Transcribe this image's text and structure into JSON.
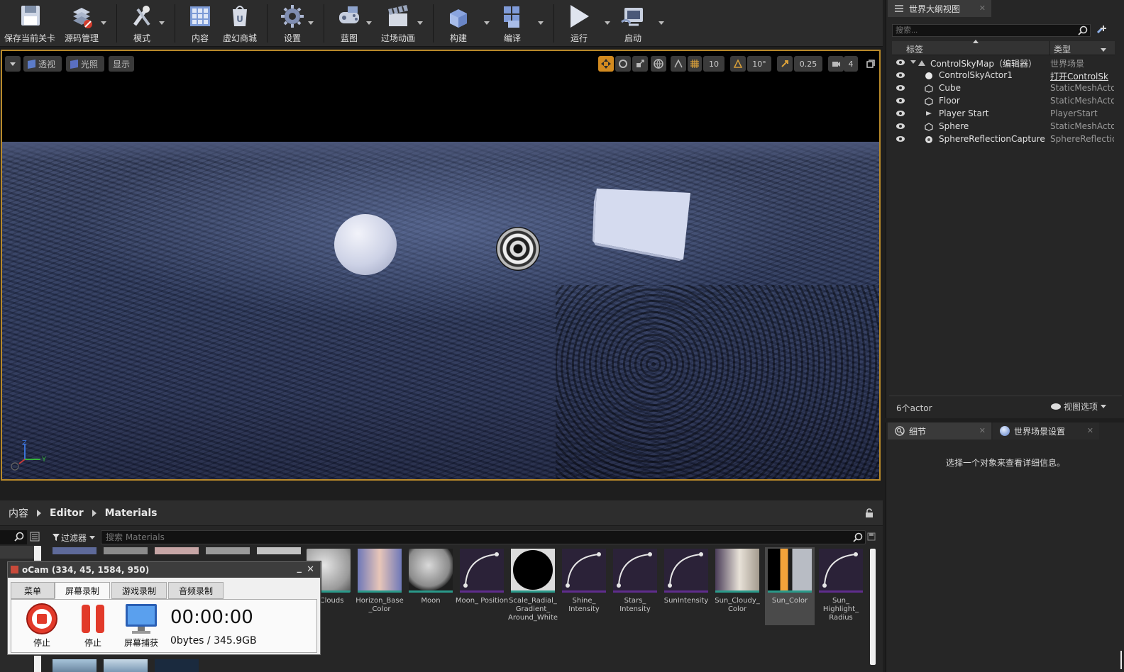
{
  "toolbar": {
    "items": [
      {
        "label": "保存当前关卡",
        "icon": "save-icon"
      },
      {
        "label": "源码管理",
        "icon": "source-control-icon"
      },
      {
        "label": "模式",
        "icon": "modes-icon"
      },
      {
        "label": "内容",
        "icon": "content-icon"
      },
      {
        "label": "虚幻商城",
        "icon": "marketplace-icon"
      },
      {
        "label": "设置",
        "icon": "settings-icon"
      },
      {
        "label": "蓝图",
        "icon": "blueprint-icon"
      },
      {
        "label": "过场动画",
        "icon": "cinematics-icon"
      },
      {
        "label": "构建",
        "icon": "build-icon"
      },
      {
        "label": "编译",
        "icon": "compile-icon"
      },
      {
        "label": "运行",
        "icon": "play-icon"
      },
      {
        "label": "启动",
        "icon": "launch-icon"
      }
    ]
  },
  "viewport": {
    "perspective_label": "透视",
    "lit_label": "光照",
    "show_label": "显示",
    "grid_snap_value": "10",
    "rotation_snap_value": "10°",
    "scale_snap_value": "0.25",
    "camera_speed_value": "4",
    "axis_z": "Z",
    "axis_y": "Y"
  },
  "content_browser": {
    "breadcrumb": [
      "内容",
      "Editor",
      "Materials"
    ],
    "filter_label": "过滤器",
    "search_placeholder": "搜索 Materials",
    "assets": [
      {
        "name": "r_Clouds"
      },
      {
        "name": "Horizon_Base _Color"
      },
      {
        "name": "Moon"
      },
      {
        "name": "Moon_ Position"
      },
      {
        "name": "Scale_Radial_ Gradient_ Around_White"
      },
      {
        "name": "Shine_ Intensity"
      },
      {
        "name": "Stars_ Intensity"
      },
      {
        "name": "SunIntensity"
      },
      {
        "name": "Sun_Cloudy_ Color"
      },
      {
        "name": "Sun_Color"
      },
      {
        "name": "Sun_ Highlight_ Radius"
      }
    ]
  },
  "ocam": {
    "title": "oCam (334, 45, 1584, 950)",
    "tabs": [
      "菜单",
      "屏幕录制",
      "游戏录制",
      "音频录制"
    ],
    "active_tab": "屏幕录制",
    "stop_label": "停止",
    "pause_label": "停止",
    "capture_label": "屏幕捕获",
    "timer": "00:00:00",
    "size_text": "0bytes / 345.9GB",
    "minimize": "_",
    "close": "✕"
  },
  "outliner": {
    "tab_title": "世界大纲视图",
    "search_placeholder": "搜索...",
    "col_label": "标签",
    "col_type": "类型",
    "rows": [
      {
        "name": "ControlSkyMap（编辑器）",
        "type": "世界场景",
        "icon": "world-icon"
      },
      {
        "name": "ControlSkyActor1",
        "type": "打开ControlSk",
        "icon": "sphere-actor-icon"
      },
      {
        "name": "Cube",
        "type": "StaticMeshActo",
        "icon": "static-mesh-icon"
      },
      {
        "name": "Floor",
        "type": "StaticMeshActo",
        "icon": "static-mesh-icon"
      },
      {
        "name": "Player Start",
        "type": "PlayerStart",
        "icon": "player-start-icon"
      },
      {
        "name": "Sphere",
        "type": "StaticMeshActo",
        "icon": "static-mesh-icon"
      },
      {
        "name": "SphereReflectionCapture",
        "type": "SphereReflectio",
        "icon": "reflection-capture-icon"
      }
    ],
    "actor_count": "6个actor",
    "view_options": "视图选项"
  },
  "details": {
    "tab_details": "细节",
    "tab_world_settings": "世界场景设置",
    "empty_message": "选择一个对象来查看详细信息。"
  },
  "colors": {
    "viewport_border": "#b8892a",
    "panel_bg": "#262626",
    "toolbar_bg": "#2c2c2c"
  }
}
